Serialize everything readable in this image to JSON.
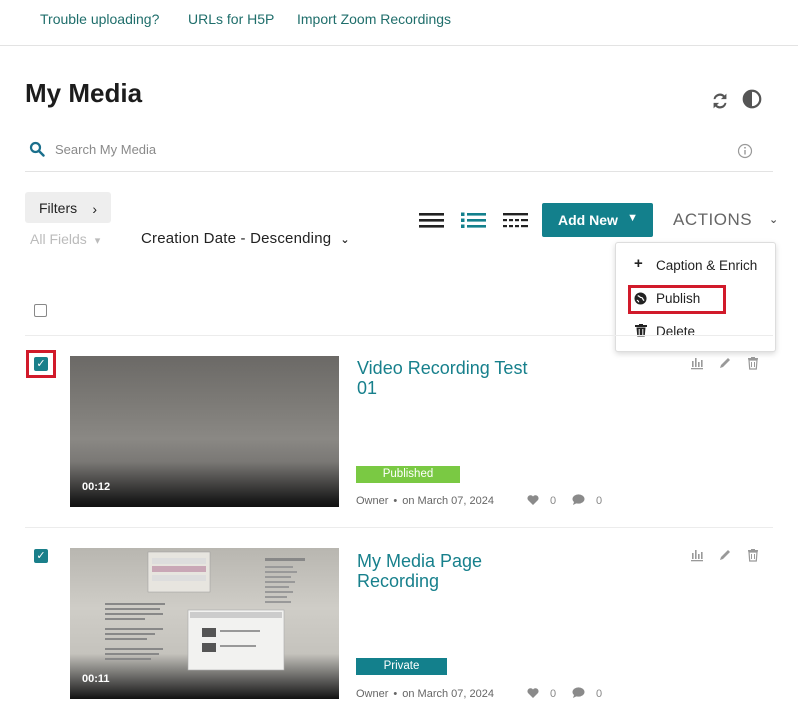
{
  "topnav": {
    "links": [
      "Trouble uploading?",
      "URLs for H5P",
      "Import Zoom Recordings"
    ]
  },
  "page": {
    "title": "My Media"
  },
  "search": {
    "placeholder": "Search My Media"
  },
  "toolbar": {
    "filters_label": "Filters",
    "all_fields": "All Fields",
    "sort": "Creation Date - Descending",
    "add_new": "Add New",
    "actions": "ACTIONS"
  },
  "actions_menu": {
    "items": [
      {
        "label": "Caption & Enrich",
        "icon": "plus-icon"
      },
      {
        "label": "Publish",
        "icon": "globe-icon"
      },
      {
        "label": "Delete",
        "icon": "trash-icon"
      }
    ]
  },
  "media": [
    {
      "title": "Video Recording Test 01",
      "duration": "00:12",
      "status": "Published",
      "owner": "Owner",
      "date": "on March 07, 2024",
      "likes": "0",
      "comments": "0",
      "checked": true
    },
    {
      "title": "My Media Page Recording",
      "duration": "00:11",
      "status": "Private",
      "owner": "Owner",
      "date": "on March 07, 2024",
      "likes": "0",
      "comments": "0",
      "checked": true
    }
  ],
  "colors": {
    "accent": "#13808c",
    "published": "#7ac943",
    "highlight": "#d11a2a"
  }
}
